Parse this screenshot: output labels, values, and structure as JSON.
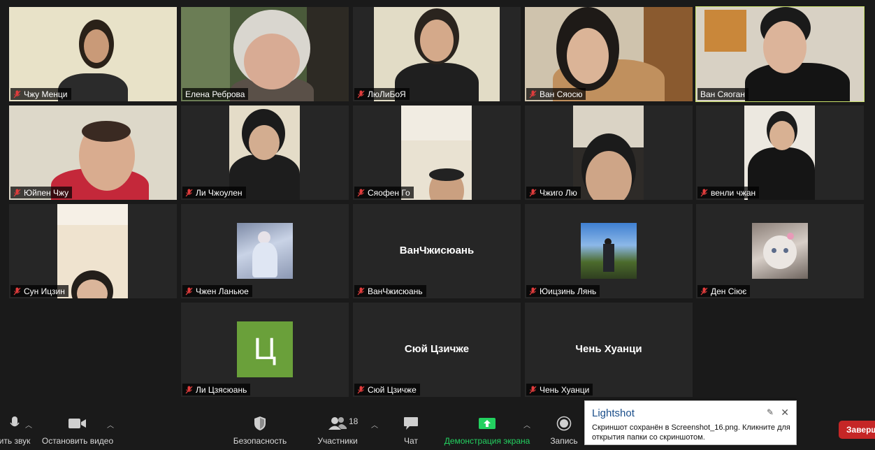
{
  "participants": [
    {
      "name": "Чжу Менци",
      "muted": true
    },
    {
      "name": "Елена Реброва",
      "muted": false
    },
    {
      "name": "ЛюЛиБоЯ",
      "muted": true
    },
    {
      "name": "Ван Сяосю",
      "muted": true
    },
    {
      "name": "Ван Сяоган",
      "muted": false,
      "active_speaker": true
    },
    {
      "name": "Юйпен Чжу",
      "muted": true
    },
    {
      "name": "Ли Чжоулен",
      "muted": true
    },
    {
      "name": "Сяофен Го",
      "muted": true
    },
    {
      "name": "Чжиго Лю",
      "muted": true
    },
    {
      "name": "венли чжан",
      "muted": true
    },
    {
      "name": "Сун Ицзин",
      "muted": true
    },
    {
      "name": "Чжен Ланьюе",
      "muted": true
    },
    {
      "name": "ВанЧжисюань",
      "muted": true,
      "center_label": "ВанЧжисюань"
    },
    {
      "name": "Юицзинь Лянь",
      "muted": true
    },
    {
      "name": "Ден Сіює",
      "muted": true
    },
    {
      "name": "Ли Цзясюань",
      "muted": true,
      "avatar_letter": "Ц"
    },
    {
      "name": "Сюй Цзичже",
      "muted": true,
      "center_label": "Сюй Цзичже"
    },
    {
      "name": "Чень Хуанци",
      "muted": true,
      "center_label": "Чень Хуанци"
    }
  ],
  "toolbar": {
    "audio_label": "ить звук",
    "video_label": "Остановить видео",
    "security_label": "Безопасность",
    "participants_label": "Участники",
    "participants_count": "18",
    "chat_label": "Чат",
    "share_label": "Демонстрация экрана",
    "record_label": "Запись",
    "end_label": "Заверш"
  },
  "colors": {
    "background": "#1a1a1a",
    "tile": "#262626",
    "active_speaker": "#c8e06a",
    "share_green": "#23d160",
    "mute_red": "#e03c3c",
    "end_red": "#c52626",
    "avatar_green": "#6aa03a"
  },
  "notification": {
    "title": "Lightshot",
    "message": "Скриншот сохранён в Screenshot_16.png. Кликните для открытия папки со скриншотом."
  }
}
